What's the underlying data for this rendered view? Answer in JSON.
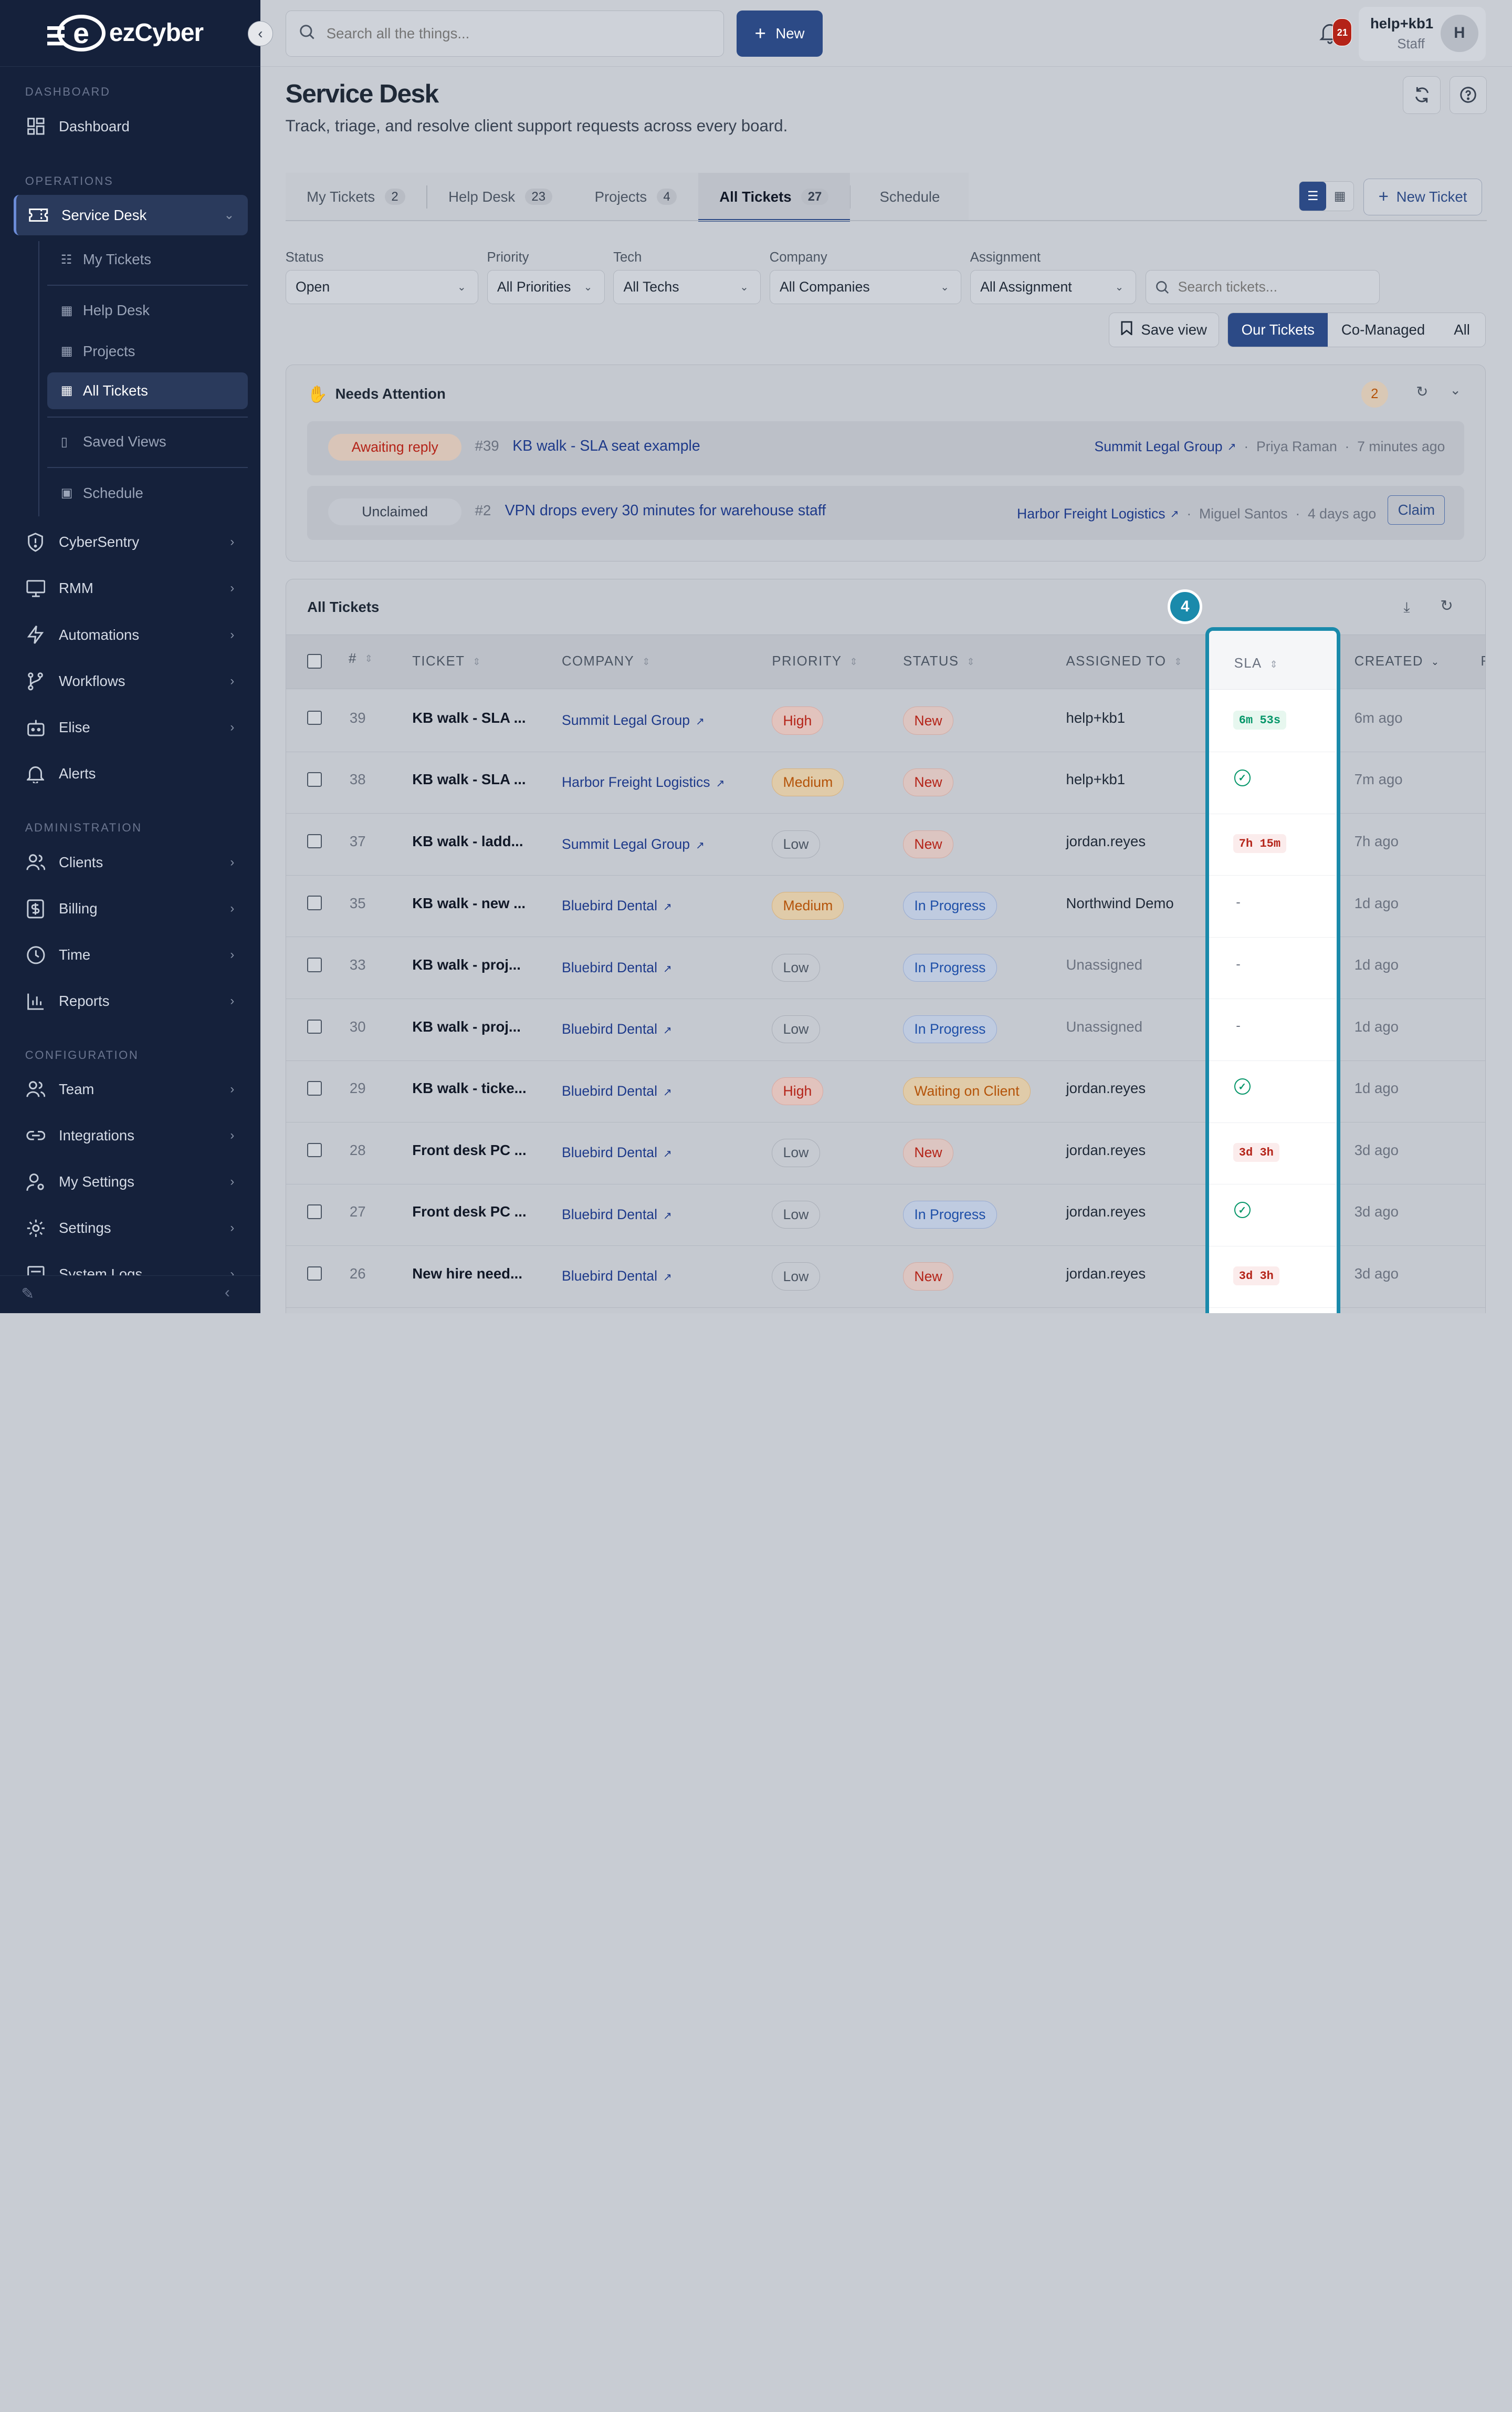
{
  "app": {
    "brand": "ezCyber"
  },
  "search": {
    "placeholder": "Search all the things..."
  },
  "topbar": {
    "new_label": "New",
    "notifications": "21",
    "user_name": "help+kb1",
    "user_role": "Staff",
    "avatar": "H"
  },
  "sidebar": {
    "sections": {
      "dashboard": "DASHBOARD",
      "operations": "OPERATIONS",
      "administration": "ADMINISTRATION",
      "configuration": "CONFIGURATION"
    },
    "dashboard": "Dashboard",
    "service_desk": "Service Desk",
    "sub": {
      "my_tickets": "My Tickets",
      "help_desk": "Help Desk",
      "projects": "Projects",
      "all_tickets": "All Tickets",
      "saved_views": "Saved Views",
      "schedule": "Schedule"
    },
    "cybersentry": "CyberSentry",
    "rmm": "RMM",
    "automations": "Automations",
    "workflows": "Workflows",
    "elise": "Elise",
    "alerts": "Alerts",
    "clients": "Clients",
    "billing": "Billing",
    "time": "Time",
    "reports": "Reports",
    "team": "Team",
    "integrations": "Integrations",
    "my_settings": "My Settings",
    "settings": "Settings",
    "system_logs": "System Logs"
  },
  "page": {
    "title": "Service Desk",
    "subtitle": "Track, triage, and resolve client support requests across every board."
  },
  "tabs": [
    {
      "label": "My Tickets",
      "count": "2"
    },
    {
      "label": "Help Desk",
      "count": "23"
    },
    {
      "label": "Projects",
      "count": "4"
    },
    {
      "label": "All Tickets",
      "count": "27"
    },
    {
      "label": "Schedule"
    }
  ],
  "new_ticket": "New Ticket",
  "filters": {
    "status": {
      "label": "Status",
      "value": "Open"
    },
    "priority": {
      "label": "Priority",
      "value": "All Priorities"
    },
    "tech": {
      "label": "Tech",
      "value": "All Techs"
    },
    "company": {
      "label": "Company",
      "value": "All Companies"
    },
    "assignment": {
      "label": "Assignment",
      "value": "All Assignment"
    },
    "search_placeholder": "Search tickets..."
  },
  "save_view": "Save view",
  "scope": [
    "Our Tickets",
    "Co-Managed",
    "All"
  ],
  "attention": {
    "title": "Needs Attention",
    "count": "2",
    "items": [
      {
        "pill": "Awaiting reply",
        "num": "#39",
        "title": "KB walk - SLA seat example",
        "company": "Summit Legal Group",
        "person": "Priya Raman",
        "time": "7 minutes ago"
      },
      {
        "pill": "Unclaimed",
        "num": "#2",
        "title": "VPN drops every 30 minutes for warehouse staff",
        "company": "Harbor Freight Logistics",
        "person": "Miguel Santos",
        "time": "4 days ago",
        "action": "Claim"
      }
    ]
  },
  "table": {
    "title": "All Tickets",
    "marker": "4",
    "columns": {
      "num": "#",
      "ticket": "TICKET",
      "company": "COMPANY",
      "priority": "PRIORITY",
      "status": "STATUS",
      "assigned": "ASSIGNED TO",
      "sla": "SLA",
      "created": "CREATED",
      "extra": "R"
    },
    "rows": [
      {
        "num": "39",
        "ticket": "KB walk - SLA ...",
        "company": "Summit Legal Group",
        "priority": "High",
        "status": "New",
        "assigned": "help+kb1",
        "sla": "6m 53s",
        "sla_kind": "green",
        "created": "6m ago"
      },
      {
        "num": "38",
        "ticket": "KB walk - SLA ...",
        "company": "Harbor Freight Logistics",
        "priority": "Medium",
        "status": "New",
        "assigned": "help+kb1",
        "sla": "",
        "sla_kind": "ok",
        "created": "7m ago"
      },
      {
        "num": "37",
        "ticket": "KB walk - ladd...",
        "company": "Summit Legal Group",
        "priority": "Low",
        "status": "New",
        "assigned": "jordan.reyes",
        "sla": "7h 15m",
        "sla_kind": "red",
        "created": "7h ago"
      },
      {
        "num": "35",
        "ticket": "KB walk - new ...",
        "company": "Bluebird Dental",
        "priority": "Medium",
        "status": "In Progress",
        "assigned": "Northwind Demo",
        "sla": "-",
        "sla_kind": "none",
        "created": "1d ago"
      },
      {
        "num": "33",
        "ticket": "KB walk - proj...",
        "company": "Bluebird Dental",
        "priority": "Low",
        "status": "In Progress",
        "assigned": "Unassigned",
        "sla": "-",
        "sla_kind": "none",
        "created": "1d ago"
      },
      {
        "num": "30",
        "ticket": "KB walk - proj...",
        "company": "Bluebird Dental",
        "priority": "Low",
        "status": "In Progress",
        "assigned": "Unassigned",
        "sla": "-",
        "sla_kind": "none",
        "created": "1d ago"
      },
      {
        "num": "29",
        "ticket": "KB walk - ticke...",
        "company": "Bluebird Dental",
        "priority": "High",
        "status": "Waiting on Client",
        "assigned": "jordan.reyes",
        "sla": "",
        "sla_kind": "ok",
        "created": "1d ago"
      },
      {
        "num": "28",
        "ticket": "Front desk PC ...",
        "company": "Bluebird Dental",
        "priority": "Low",
        "status": "New",
        "assigned": "jordan.reyes",
        "sla": "3d 3h",
        "sla_kind": "red",
        "created": "3d ago"
      },
      {
        "num": "27",
        "ticket": "Front desk PC ...",
        "company": "Bluebird Dental",
        "priority": "Low",
        "status": "In Progress",
        "assigned": "jordan.reyes",
        "sla": "",
        "sla_kind": "ok",
        "created": "3d ago"
      },
      {
        "num": "26",
        "ticket": "New hire need...",
        "company": "Bluebird Dental",
        "priority": "Low",
        "status": "New",
        "assigned": "jordan.reyes",
        "sla": "3d 3h",
        "sla_kind": "red",
        "created": "3d ago"
      }
    ]
  }
}
